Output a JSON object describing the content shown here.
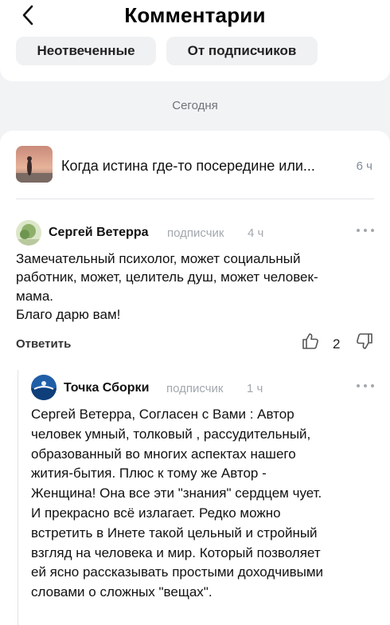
{
  "header": {
    "title": "Комментарии",
    "back_icon": "chevron-left-icon"
  },
  "filters": {
    "unanswered": "Неотвеченные",
    "from_subscribers": "От подписчиков"
  },
  "date_divider": "Сегодня",
  "post": {
    "title": "Когда истина где-то посередине или...",
    "time": "6 ч"
  },
  "comments": [
    {
      "author": "Сергей Ветерра",
      "role": "подписчик",
      "time": "4 ч",
      "lines": [
        "Замечательный психолог, может социальный",
        "работник, может, целитель душ, может человек-",
        "мама.",
        "Благо дарю вам!"
      ],
      "reply_label": "Ответить",
      "likes": "2"
    },
    {
      "author": "Точка Сборки",
      "role": "подписчик",
      "time": "1 ч",
      "lines": [
        "Сергей Ветерра, Согласен с Вами : Автор",
        "человек умный, толковый , рассудительный,",
        "образованный во многих аспектах нашего",
        "жития-бытия. Плюс к тому же Автор -",
        "Женщина! Она все эти \"знания\" сердцем чует.",
        "И прекрасно всё излагает. Редко можно",
        "встретить в Инете такой цельный и стройный",
        "взгляд на человека и мир. Который позволяет",
        "ей ясно рассказывать простыми доходчивыми",
        "словами о сложных \"вещах\"."
      ]
    }
  ],
  "colors": {
    "background": "#f2f3f5",
    "secondary_text": "#818c99",
    "chip_bg": "#f0f1f3"
  }
}
